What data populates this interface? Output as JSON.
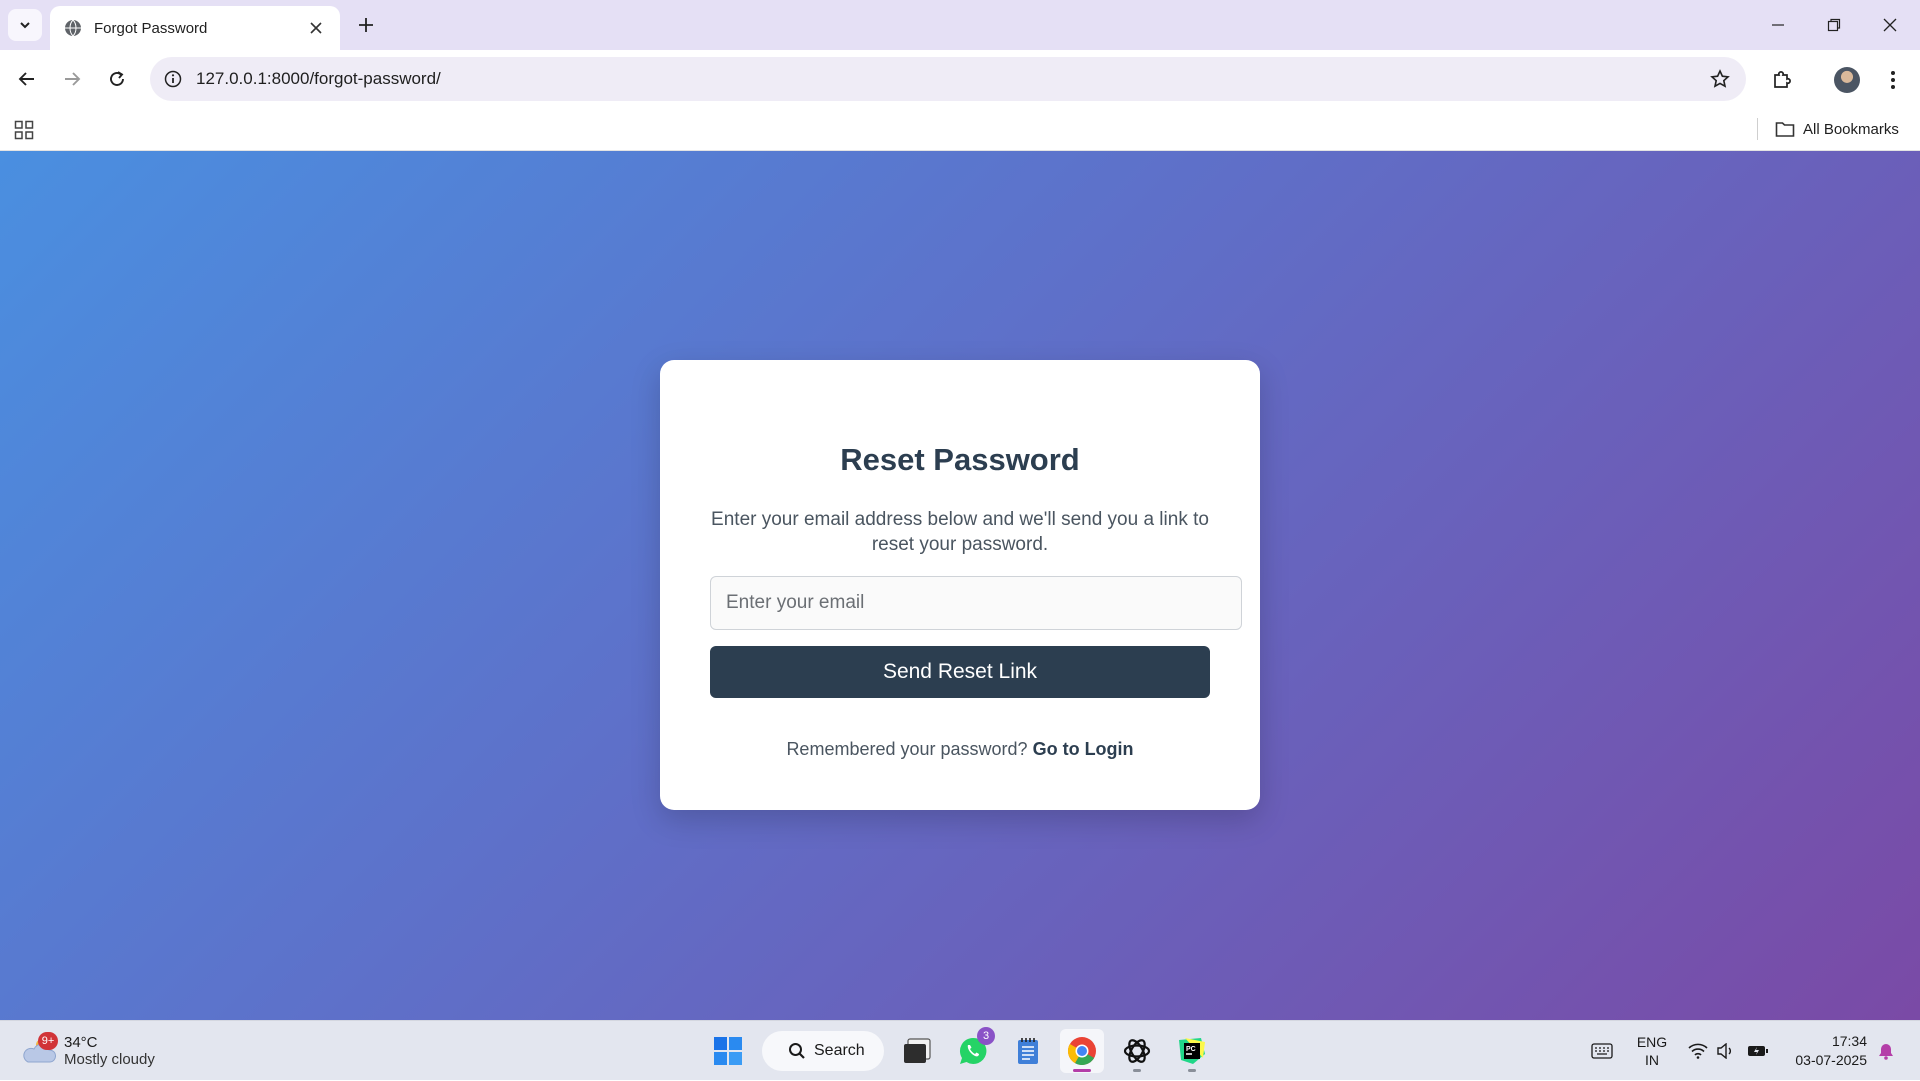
{
  "browser": {
    "tab_title": "Forgot Password",
    "url": "127.0.0.1:8000/forgot-password/",
    "bookmarks_label": "All Bookmarks"
  },
  "page": {
    "heading": "Reset Password",
    "description": "Enter your email address below and we'll send you a link to reset your password.",
    "email_placeholder": "Enter your email",
    "submit_label": "Send Reset Link",
    "footer_text": "Remembered your password?",
    "login_link": "Go to Login",
    "colors": {
      "card_heading": "#2c3e50",
      "button_bg": "#2c3e50",
      "gradient_start": "#4a8fe0",
      "gradient_end": "#7a4aa6"
    }
  },
  "taskbar": {
    "weather_badge": "9+",
    "weather_temp": "34°C",
    "weather_condition": "Mostly cloudy",
    "search_label": "Search",
    "whatsapp_badge": "3",
    "language_line1": "ENG",
    "language_line2": "IN",
    "time": "17:34",
    "date": "03-07-2025",
    "icons": [
      "start-icon",
      "search-icon",
      "file-explorer-icon",
      "whatsapp-icon",
      "notepad-icon",
      "chrome-icon",
      "chatgpt-icon",
      "pycharm-icon"
    ]
  }
}
